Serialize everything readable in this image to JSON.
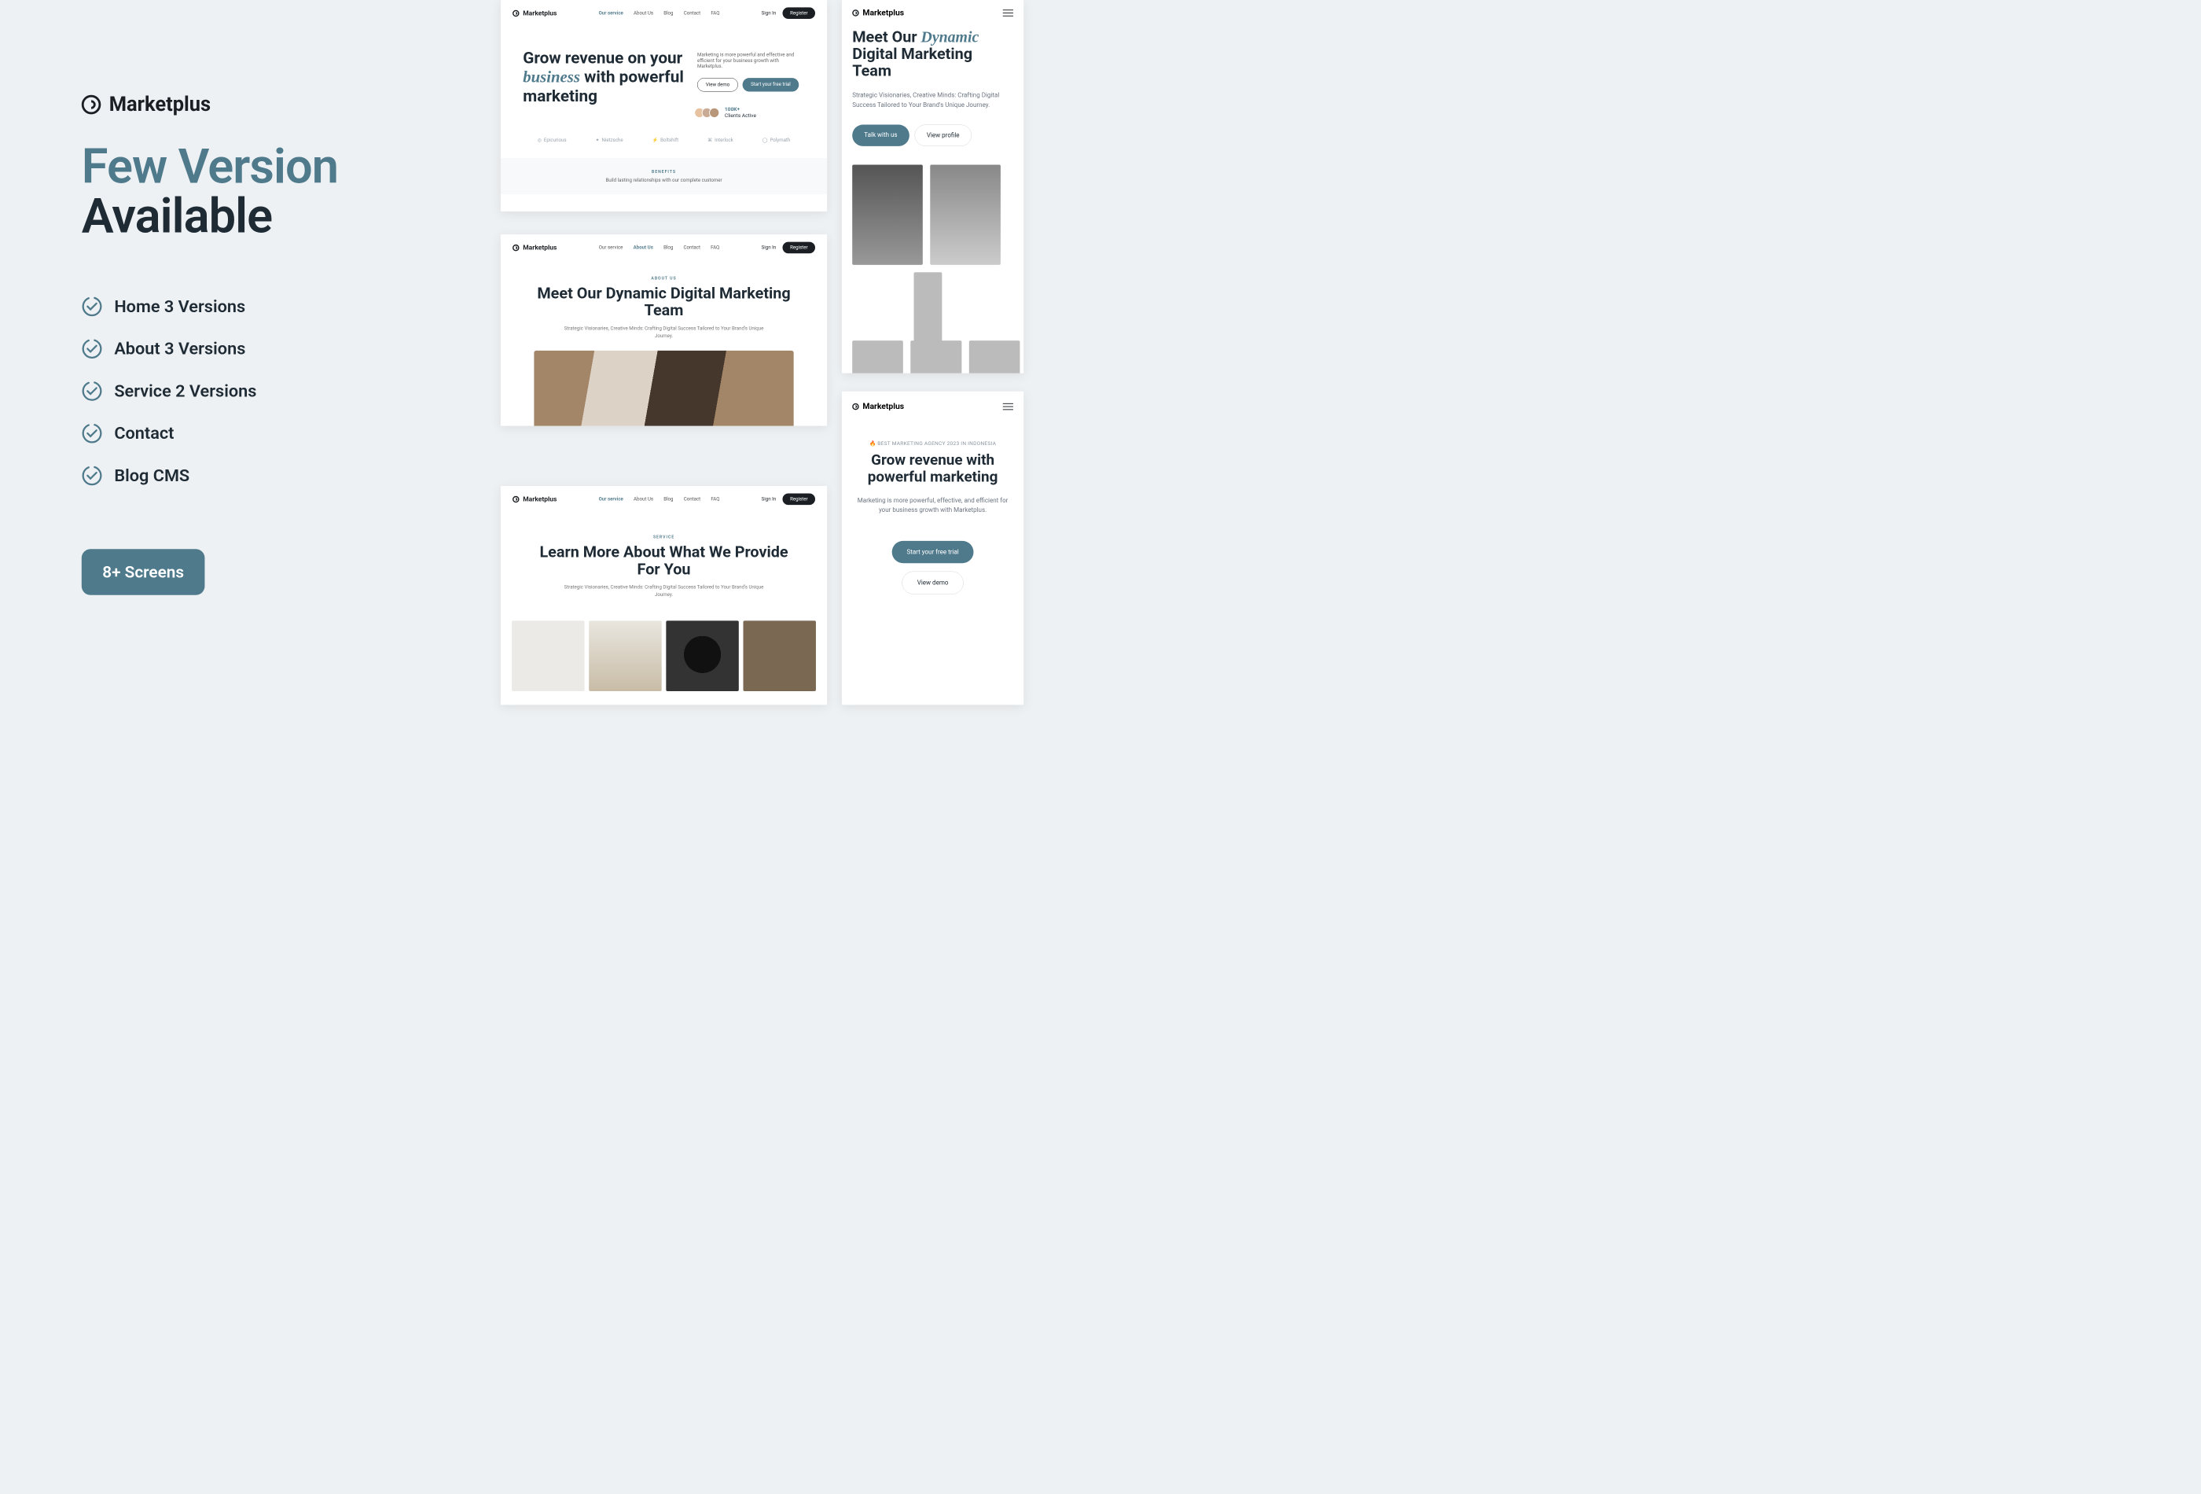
{
  "brand": {
    "name": "Marketplus"
  },
  "headline": {
    "line1": "Few Version",
    "line2": "Available"
  },
  "features": [
    {
      "label": "Home 3 Versions"
    },
    {
      "label": "About 3 Versions"
    },
    {
      "label": "Service 2 Versions"
    },
    {
      "label": "Contact"
    },
    {
      "label": "Blog CMS"
    }
  ],
  "cta": {
    "label": "8+ Screens"
  },
  "nav": {
    "items": [
      "Our service",
      "About Us",
      "Blog",
      "Contact",
      "FAQ"
    ],
    "signin": "Sign In",
    "register": "Register"
  },
  "card_home": {
    "h1_a": "Grow revenue on your ",
    "h1_b": "business",
    "h1_c": " with powerful marketing",
    "sub": "Marketing is more powerful and effective and efficient for your business growth with Marketplus.",
    "cta_outline": "View demo",
    "cta_teal": "Start your free trial",
    "stat_value": "100K+",
    "stat_label": "Clients Active",
    "logos": [
      "Epicurious",
      "Nietzsche",
      "Boltshift",
      "Interlock",
      "Polymath"
    ],
    "benefits_eyebrow": "BENEFITS",
    "benefits_tagline": "Build lasting relationships with our complete customer"
  },
  "card_about": {
    "eyebrow": "ABOUT US",
    "title": "Meet Our Dynamic Digital Marketing Team",
    "sub": "Strategic Visionaries, Creative Minds: Crafting Digital Success Tailored to Your Brand's Unique Journey."
  },
  "card_service": {
    "eyebrow": "SERVICE",
    "title": "Learn More About What We Provide For You",
    "sub": "Strategic Visionaries, Creative Minds: Crafting Digital Success Tailored to Your Brand's Unique Journey."
  },
  "m_team": {
    "h_a": "Meet Our ",
    "h_b": "Dynamic",
    "h_c": " Digital Marketing Team",
    "sub": "Strategic Visionaries, Creative Minds: Crafting Digital Success Tailored to Your Brand's Unique Journey.",
    "cta_primary": "Talk with us",
    "cta_secondary": "View profile"
  },
  "m_hero": {
    "eyebrow": "🔥 BEST MARKETING AGENCY 2023 IN INDONESIA",
    "title": "Grow revenue with powerful marketing",
    "sub": "Marketing is more powerful, effective, and efficient for your business growth with Marketplus.",
    "cta_primary": "Start your free trial",
    "cta_secondary": "View demo"
  }
}
